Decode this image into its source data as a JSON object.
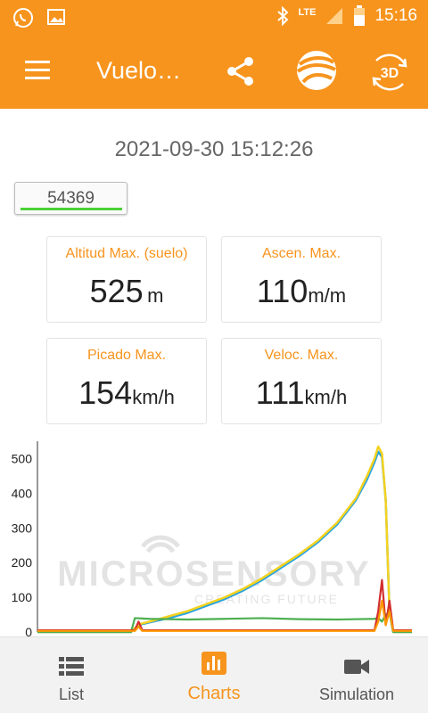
{
  "status_bar": {
    "time": "15:16",
    "network": "LTE"
  },
  "app_bar": {
    "title": "Vuelo…"
  },
  "flight": {
    "datetime": "2021-09-30 15:12:26",
    "id": "54369"
  },
  "stats": [
    {
      "label": "Altitud Max. (suelo)",
      "value": "525",
      "unit": "m"
    },
    {
      "label": "Ascen. Max.",
      "value": "110",
      "unit": "m/m"
    },
    {
      "label": "Picado Max.",
      "value": "154",
      "unit": "km/h"
    },
    {
      "label": "Veloc. Max.",
      "value": "111",
      "unit": "km/h"
    }
  ],
  "watermark": {
    "brand": "MICROSENSORY",
    "tagline": "CREATING FUTURE"
  },
  "chart_data": {
    "type": "line",
    "ylim": [
      0,
      540
    ],
    "yticks": [
      "0",
      "100",
      "200",
      "300",
      "400",
      "500"
    ],
    "xlim": [
      0,
      100
    ],
    "series": [
      {
        "color": "#29a3e0",
        "x": [
          0,
          25,
          27,
          30,
          35,
          40,
          45,
          50,
          55,
          60,
          65,
          70,
          75,
          80,
          85,
          88,
          90,
          91,
          92,
          93,
          94,
          95,
          100
        ],
        "y": [
          0,
          0,
          20,
          28,
          40,
          55,
          75,
          95,
          120,
          150,
          185,
          220,
          260,
          310,
          380,
          440,
          490,
          520,
          505,
          380,
          60,
          0,
          0
        ]
      },
      {
        "color": "#f4d21f",
        "x": [
          0,
          25,
          27,
          30,
          35,
          40,
          45,
          50,
          55,
          60,
          65,
          70,
          75,
          80,
          85,
          88,
          90,
          91,
          92,
          93,
          94,
          95,
          100
        ],
        "y": [
          0,
          0,
          22,
          30,
          45,
          60,
          80,
          100,
          125,
          155,
          190,
          225,
          265,
          315,
          385,
          450,
          500,
          535,
          515,
          380,
          60,
          0,
          0
        ]
      },
      {
        "color": "#4caf50",
        "x": [
          0,
          25,
          26,
          30,
          40,
          50,
          60,
          70,
          80,
          90,
          91,
          92,
          93,
          94,
          95,
          100
        ],
        "y": [
          0,
          0,
          40,
          38,
          36,
          38,
          40,
          37,
          36,
          38,
          40,
          30,
          50,
          55,
          0,
          0
        ]
      },
      {
        "color": "#d32f2f",
        "x": [
          0,
          10,
          26,
          27,
          28,
          50,
          90,
          91,
          92,
          93,
          94,
          95,
          100
        ],
        "y": [
          5,
          5,
          5,
          30,
          5,
          5,
          5,
          60,
          150,
          20,
          90,
          5,
          5
        ]
      },
      {
        "color": "#ff9800",
        "x": [
          0,
          26,
          27,
          28,
          50,
          90,
          91,
          92,
          93,
          94,
          95,
          100
        ],
        "y": [
          3,
          3,
          15,
          3,
          3,
          3,
          30,
          90,
          20,
          60,
          3,
          3
        ]
      }
    ]
  },
  "nav": [
    {
      "label": "List",
      "icon": "list-icon"
    },
    {
      "label": "Charts",
      "icon": "bar-chart-icon"
    },
    {
      "label": "Simulation",
      "icon": "video-camera-icon"
    }
  ],
  "colors": {
    "accent": "#f7941d",
    "badge_bar": "#4cd137"
  }
}
